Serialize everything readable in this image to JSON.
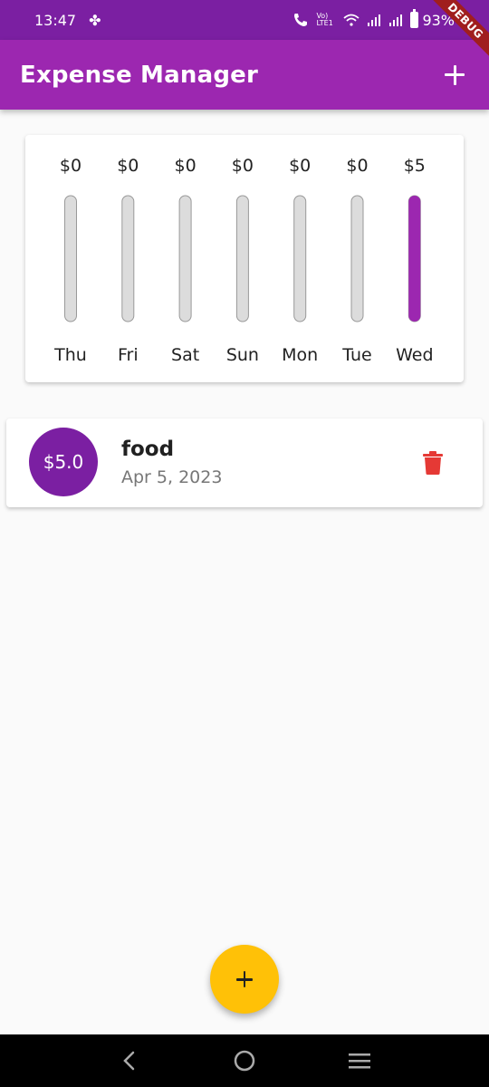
{
  "status_bar": {
    "time": "13:47",
    "battery": "93%",
    "volte": "Vo) LTE1"
  },
  "debug_label": "DEBUG",
  "app_bar": {
    "title": "Expense Manager",
    "add_icon": "plus-icon"
  },
  "chart_data": {
    "type": "bar",
    "categories": [
      "Thu",
      "Fri",
      "Sat",
      "Sun",
      "Mon",
      "Tue",
      "Wed"
    ],
    "values": [
      0,
      0,
      0,
      0,
      0,
      0,
      5
    ],
    "value_labels": [
      "$0",
      "$0",
      "$0",
      "$0",
      "$0",
      "$0",
      "$5"
    ],
    "ylim": [
      0,
      5
    ],
    "fill_color": "#9c27b0",
    "track_color": "#dcdcdc"
  },
  "transactions": [
    {
      "amount": "$5.0",
      "title": "food",
      "date": "Apr 5, 2023",
      "delete_icon": "trash-icon"
    }
  ],
  "fab": {
    "icon": "plus-icon"
  },
  "colors": {
    "primary": "#9c27b0",
    "primary_dark": "#7b1fa2",
    "accent": "#ffc107",
    "delete": "#e53935"
  },
  "nav": {
    "back": "back-icon",
    "home": "home-icon",
    "recents": "menu-icon"
  }
}
